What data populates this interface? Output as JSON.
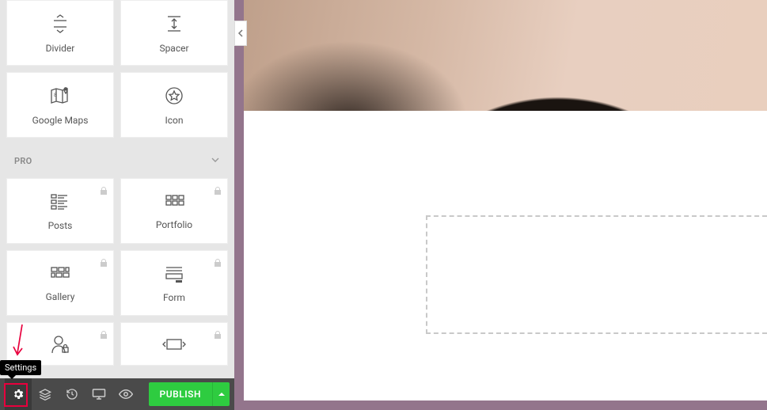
{
  "widgets_basic": [
    {
      "id": "divider",
      "label": "Divider"
    },
    {
      "id": "spacer",
      "label": "Spacer"
    },
    {
      "id": "maps",
      "label": "Google Maps"
    },
    {
      "id": "icon",
      "label": "Icon"
    }
  ],
  "section_pro": {
    "title": "PRO"
  },
  "widgets_pro": [
    {
      "id": "posts",
      "label": "Posts",
      "locked": true
    },
    {
      "id": "portfolio",
      "label": "Portfolio",
      "locked": true
    },
    {
      "id": "gallery",
      "label": "Gallery",
      "locked": true
    },
    {
      "id": "form",
      "label": "Form",
      "locked": true
    },
    {
      "id": "login",
      "label": "",
      "locked": true
    },
    {
      "id": "slides",
      "label": "",
      "locked": true
    }
  ],
  "tooltip": {
    "settings": "Settings"
  },
  "bottom": {
    "publish_label": "PUBLISH"
  }
}
